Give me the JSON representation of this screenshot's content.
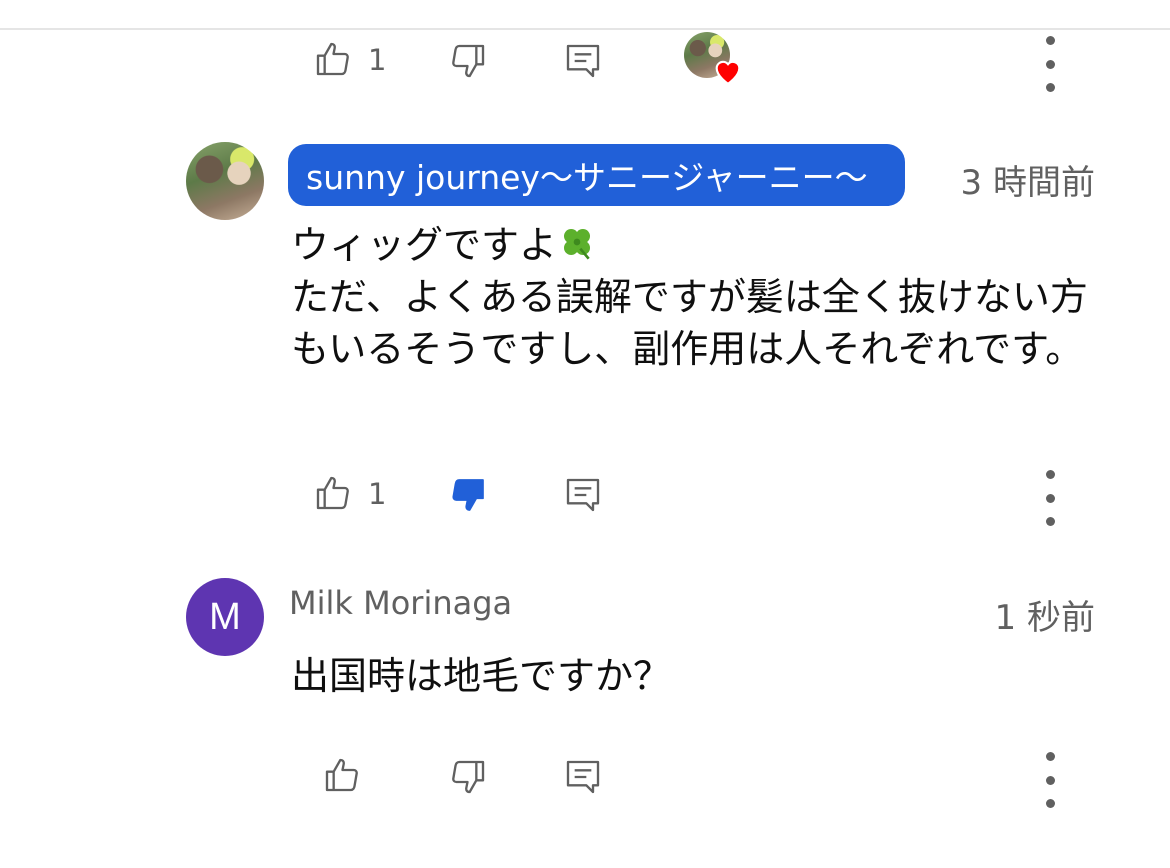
{
  "reply_1": {
    "likes": "1",
    "icons": [
      "thumb-up-icon",
      "thumb-down-icon",
      "reply-icon",
      "creator-heart-avatar",
      "more-vert-icon"
    ]
  },
  "reply_2": {
    "author": "sunny journey〜サニージャーニー〜",
    "time": "3 時間前",
    "text": "ウィッグですよ",
    "text_emoji": "four-leaf-clover",
    "text_rest": "ただ、よくある誤解ですが髪は全く抜けない方もいるそうですし、副作用は人それぞれです。",
    "likes": "1",
    "disliked": true,
    "colors": {
      "chip": "#2160d8",
      "dislike_active": "#2160d8"
    }
  },
  "reply_3": {
    "avatar_letter": "M",
    "author": "Milk Morinaga",
    "time": "1 秒前",
    "text": "出国時は地毛ですか？",
    "colors": {
      "avatar": "#5e35b1"
    }
  }
}
